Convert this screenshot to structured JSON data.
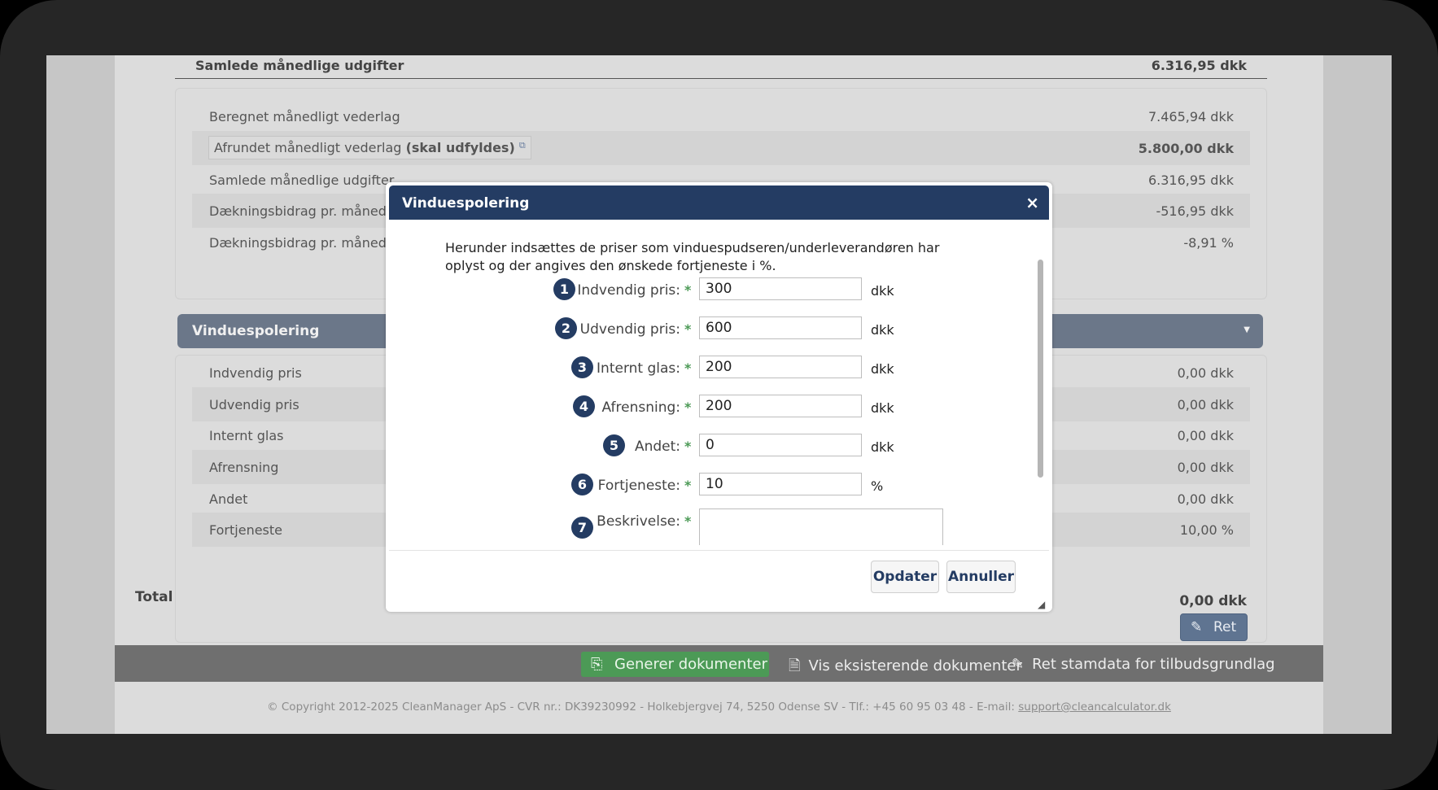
{
  "summary": {
    "header_label": "Samlede månedlige udgifter",
    "header_value": "6.316,95 dkk",
    "rows": [
      {
        "label": "Beregnet månedligt vederlag",
        "value": "7.465,94 dkk"
      },
      {
        "label": "Afrundet månedligt vederlag",
        "label_bold": "(skal udfyldes)",
        "value": "5.800,00 dkk"
      },
      {
        "label": "Samlede månedlige udgifter",
        "value": "6.316,95 dkk"
      },
      {
        "label": "Dækningsbidrag pr. måned",
        "value": "-516,95 dkk"
      },
      {
        "label": "Dækningsbidrag pr. måned",
        "value": "-8,91 %"
      }
    ]
  },
  "section": {
    "title": "Vinduespolering",
    "rows": [
      {
        "label": "Indvendig pris",
        "value": "0,00 dkk"
      },
      {
        "label": "Udvendig pris",
        "value": "0,00 dkk"
      },
      {
        "label": "Internt glas",
        "value": "0,00 dkk"
      },
      {
        "label": "Afrensning",
        "value": "0,00 dkk"
      },
      {
        "label": "Andet",
        "value": "0,00 dkk"
      },
      {
        "label": "Fortjeneste",
        "value": "10,00 %"
      }
    ],
    "total_label": "Total",
    "total_value": "0,00 dkk",
    "edit_label": "Ret"
  },
  "actionbar": {
    "generate_label": "Generer dokumenter",
    "view_docs_label": "Vis eksisterende dokumenter",
    "edit_master_label": "Ret stamdata for tilbudsgrundlag"
  },
  "footer": {
    "text": "© Copyright 2012-2025 CleanManager ApS - CVR nr.: DK39230992 - Holkebjergvej 74, 5250 Odense SV - Tlf.: +45 60 95 03 48 - E-mail:",
    "email": "support@cleancalculator.dk"
  },
  "modal": {
    "title": "Vinduespolering",
    "close_glyph": "×",
    "intro": "Herunder indsættes de priser som vinduespudseren/underleverandøren har oplyst og der angives den ønskede fortjeneste i %.",
    "required_mark": "*",
    "fields": [
      {
        "num": "1",
        "label": "Indvendig pris:",
        "value": "300",
        "unit": "dkk"
      },
      {
        "num": "2",
        "label": "Udvendig pris:",
        "value": "600",
        "unit": "dkk"
      },
      {
        "num": "3",
        "label": "Internt glas:",
        "value": "200",
        "unit": "dkk"
      },
      {
        "num": "4",
        "label": "Afrensning:",
        "value": "200",
        "unit": "dkk"
      },
      {
        "num": "5",
        "label": "Andet:",
        "value": "0",
        "unit": "dkk"
      },
      {
        "num": "6",
        "label": "Fortjeneste:",
        "value": "10",
        "unit": "%"
      },
      {
        "num": "7",
        "label": "Beskrivelse:",
        "value": "",
        "unit": ""
      }
    ],
    "update_label": "Opdater",
    "cancel_label": "Annuller"
  },
  "icons": {
    "external_link": "external-link-icon",
    "caret": "caret-down-icon",
    "pencil": "pencil-icon",
    "document_generate": "document-import-icon",
    "document": "document-icon",
    "resize": "resize-grip-icon"
  },
  "colors": {
    "accent": "#243c63",
    "accordion": "#6b7789",
    "success": "#4c9a56",
    "required": "#4c9a56"
  }
}
